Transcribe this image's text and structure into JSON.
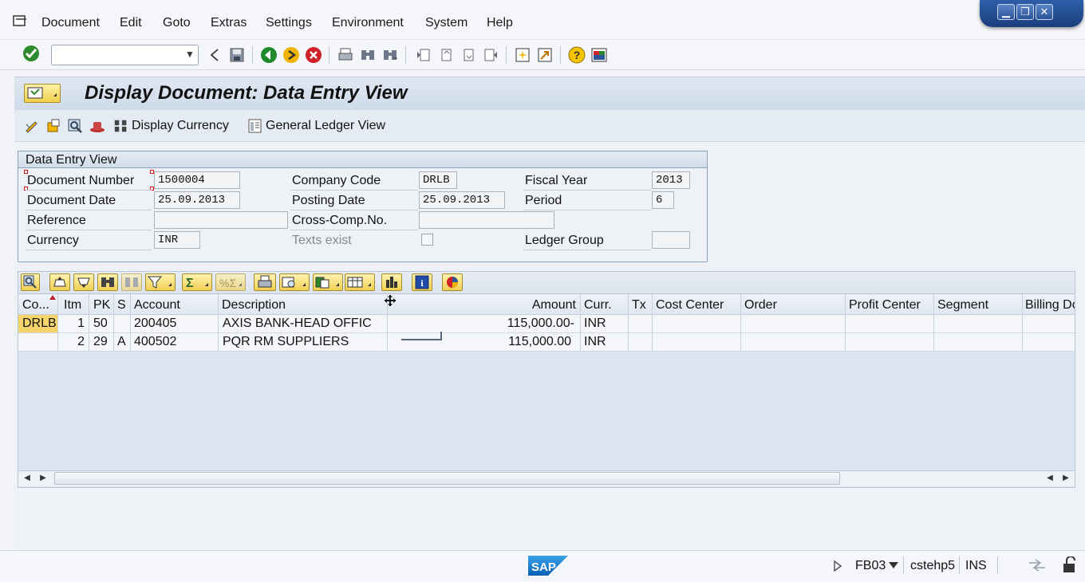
{
  "menu": [
    "Document",
    "Edit",
    "Goto",
    "Extras",
    "Settings",
    "Environment",
    "System",
    "Help"
  ],
  "toolbar": {
    "command_field_value": "",
    "icons": [
      "enter-icon",
      "save-icon",
      "back-icon",
      "exit-icon",
      "cancel-icon",
      "print-icon",
      "find-icon",
      "find-next-icon",
      "first-page-icon",
      "previous-page-icon",
      "next-page-icon",
      "last-page-icon",
      "new-session-icon",
      "shortcut-icon",
      "help-icon",
      "customize-layout-icon"
    ]
  },
  "title": "Display Document: Data Entry View",
  "app_toolbar": {
    "display_currency_label": "Display Currency",
    "general_ledger_view_label": "General Ledger View"
  },
  "header": {
    "group_title": "Data Entry View",
    "document_number": {
      "label": "Document Number",
      "value": "1500004"
    },
    "company_code": {
      "label": "Company Code",
      "value": "DRLB"
    },
    "fiscal_year": {
      "label": "Fiscal Year",
      "value": "2013"
    },
    "document_date": {
      "label": "Document Date",
      "value": "25.09.2013"
    },
    "posting_date": {
      "label": "Posting Date",
      "value": "25.09.2013"
    },
    "period": {
      "label": "Period",
      "value": "6"
    },
    "reference": {
      "label": "Reference",
      "value": ""
    },
    "cross_comp_no": {
      "label": "Cross-Comp.No.",
      "value": ""
    },
    "currency": {
      "label": "Currency",
      "value": "INR"
    },
    "texts_exist": {
      "label": "Texts exist",
      "checked": false
    },
    "ledger_group": {
      "label": "Ledger Group",
      "value": ""
    }
  },
  "grid": {
    "columns": [
      "Co...",
      "Itm",
      "PK",
      "S",
      "Account",
      "Description",
      "Amount",
      "Curr.",
      "Tx",
      "Cost Center",
      "Order",
      "Profit Center",
      "Segment",
      "Billing Do"
    ],
    "rows": [
      {
        "co": "DRLB",
        "itm": "1",
        "pk": "50",
        "s": "",
        "account": "200405",
        "description": "AXIS BANK-HEAD OFFIC",
        "amount": "115,000.00-",
        "curr": "INR",
        "tx": "",
        "cost_center": "",
        "order": "",
        "profit_center": "",
        "segment": "",
        "billing": ""
      },
      {
        "co": "",
        "itm": "2",
        "pk": "29",
        "s": "A",
        "account": "400502",
        "description": "PQR RM SUPPLIERS",
        "amount": "115,000.00",
        "curr": "INR",
        "tx": "",
        "cost_center": "",
        "order": "",
        "profit_center": "",
        "segment": "",
        "billing": ""
      }
    ]
  },
  "status": {
    "transaction": "FB03",
    "server": "cstehp5",
    "mode": "INS",
    "logo_text": "SAP"
  },
  "colors": {
    "title_bar": "#d6e0ec",
    "selected_cell": "#f7d36b",
    "window_controls": "#2b5398"
  }
}
